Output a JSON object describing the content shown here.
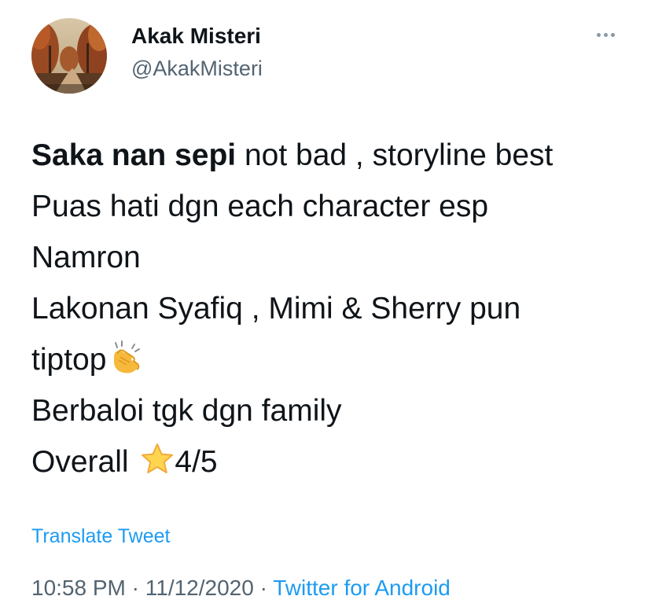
{
  "author": {
    "display_name": "Akak Misteri",
    "handle": "@AkakMisteri",
    "avatar_icon": "autumn-forest-avatar"
  },
  "more_icon": "more-options-icon",
  "tweet": {
    "title_bold": "Saka nan sepi",
    "line1_rest": " not bad , storyline best",
    "line2": "Puas hati dgn each character esp",
    "line3": "Namron",
    "line4": "Lakonan Syafiq , Mimi & Sherry pun",
    "line5": "tiptop",
    "line5_emoji": "clapping-hands-emoji",
    "line6": "Berbaloi tgk dgn family",
    "line7_prefix": "Overall",
    "line7_emoji": "star-emoji",
    "line7_suffix": "4/5"
  },
  "translate_label": "Translate Tweet",
  "meta": {
    "time": "10:58 PM",
    "separator": " · ",
    "date": "11/12/2020",
    "source": "Twitter for Android"
  },
  "colors": {
    "accent": "#1d9bf0",
    "secondary_text": "#536471",
    "primary_text": "#0f1419"
  }
}
